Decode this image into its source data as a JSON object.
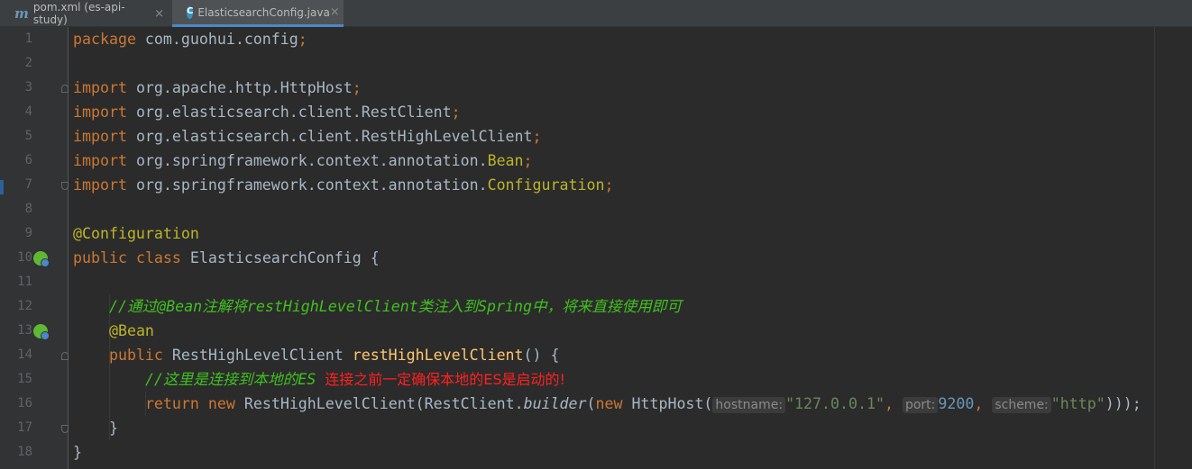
{
  "tabs": [
    {
      "icon": "maven-icon",
      "label": "pom.xml (es-api-study)",
      "close": "×"
    },
    {
      "icon": "class-icon",
      "label": "ElasticsearchConfig.java",
      "close": "×"
    }
  ],
  "line_numbers": [
    "1",
    "2",
    "3",
    "4",
    "5",
    "6",
    "7",
    "8",
    "9",
    "10",
    "11",
    "12",
    "13",
    "14",
    "15",
    "16",
    "17",
    "18"
  ],
  "code": {
    "l1": {
      "kw": "package",
      "rest": " com.guohui.config",
      "semi": ";"
    },
    "l3": {
      "kw": "import",
      "rest": " org.apache.http.HttpHost",
      "semi": ";"
    },
    "l4": {
      "kw": "import",
      "rest": " org.elasticsearch.client.RestClient",
      "semi": ";"
    },
    "l5": {
      "kw": "import",
      "rest": " org.elasticsearch.client.RestHighLevelClient",
      "semi": ";"
    },
    "l6": {
      "kw": "import",
      "rest": " org.springframework.context.annotation.",
      "ann": "Bean",
      "semi": ";"
    },
    "l7": {
      "kw": "import",
      "rest": " org.springframework.context.annotation.",
      "ann": "Configuration",
      "semi": ";"
    },
    "l9": {
      "ann": "@Configuration"
    },
    "l10": {
      "kw1": "public",
      "kw2": "class",
      "rest": " ElasticsearchConfig {"
    },
    "l12": {
      "comment": "//通过@Bean注解将restHighLevelClient类注入到Spring中，将来直接使用即可"
    },
    "l13": {
      "ann": "@Bean"
    },
    "l14": {
      "kw": "public",
      "type": " RestHighLevelClient ",
      "fn": "restHighLevelClient",
      "rest": "() {"
    },
    "l15": {
      "comment": "//这里是连接到本地的ES",
      "note": "连接之前一定确保本地的ES是启动的!"
    },
    "l16": {
      "kw": "return",
      "new1": "new",
      "p1": " RestHighLevelClient(RestClient.",
      "builder": "builder",
      "p2": "(",
      "new2": "new",
      "p3": " HttpHost(",
      "hint1": "hostname:",
      "str1": "\"127.0.0.1\"",
      "comma1": ", ",
      "hint2": "port:",
      "num": "9200",
      "comma2": ", ",
      "hint3": "scheme:",
      "str2": "\"http\"",
      "end": ")));"
    },
    "l17": {
      "rest": "}"
    },
    "l18": {
      "rest": "}"
    }
  }
}
